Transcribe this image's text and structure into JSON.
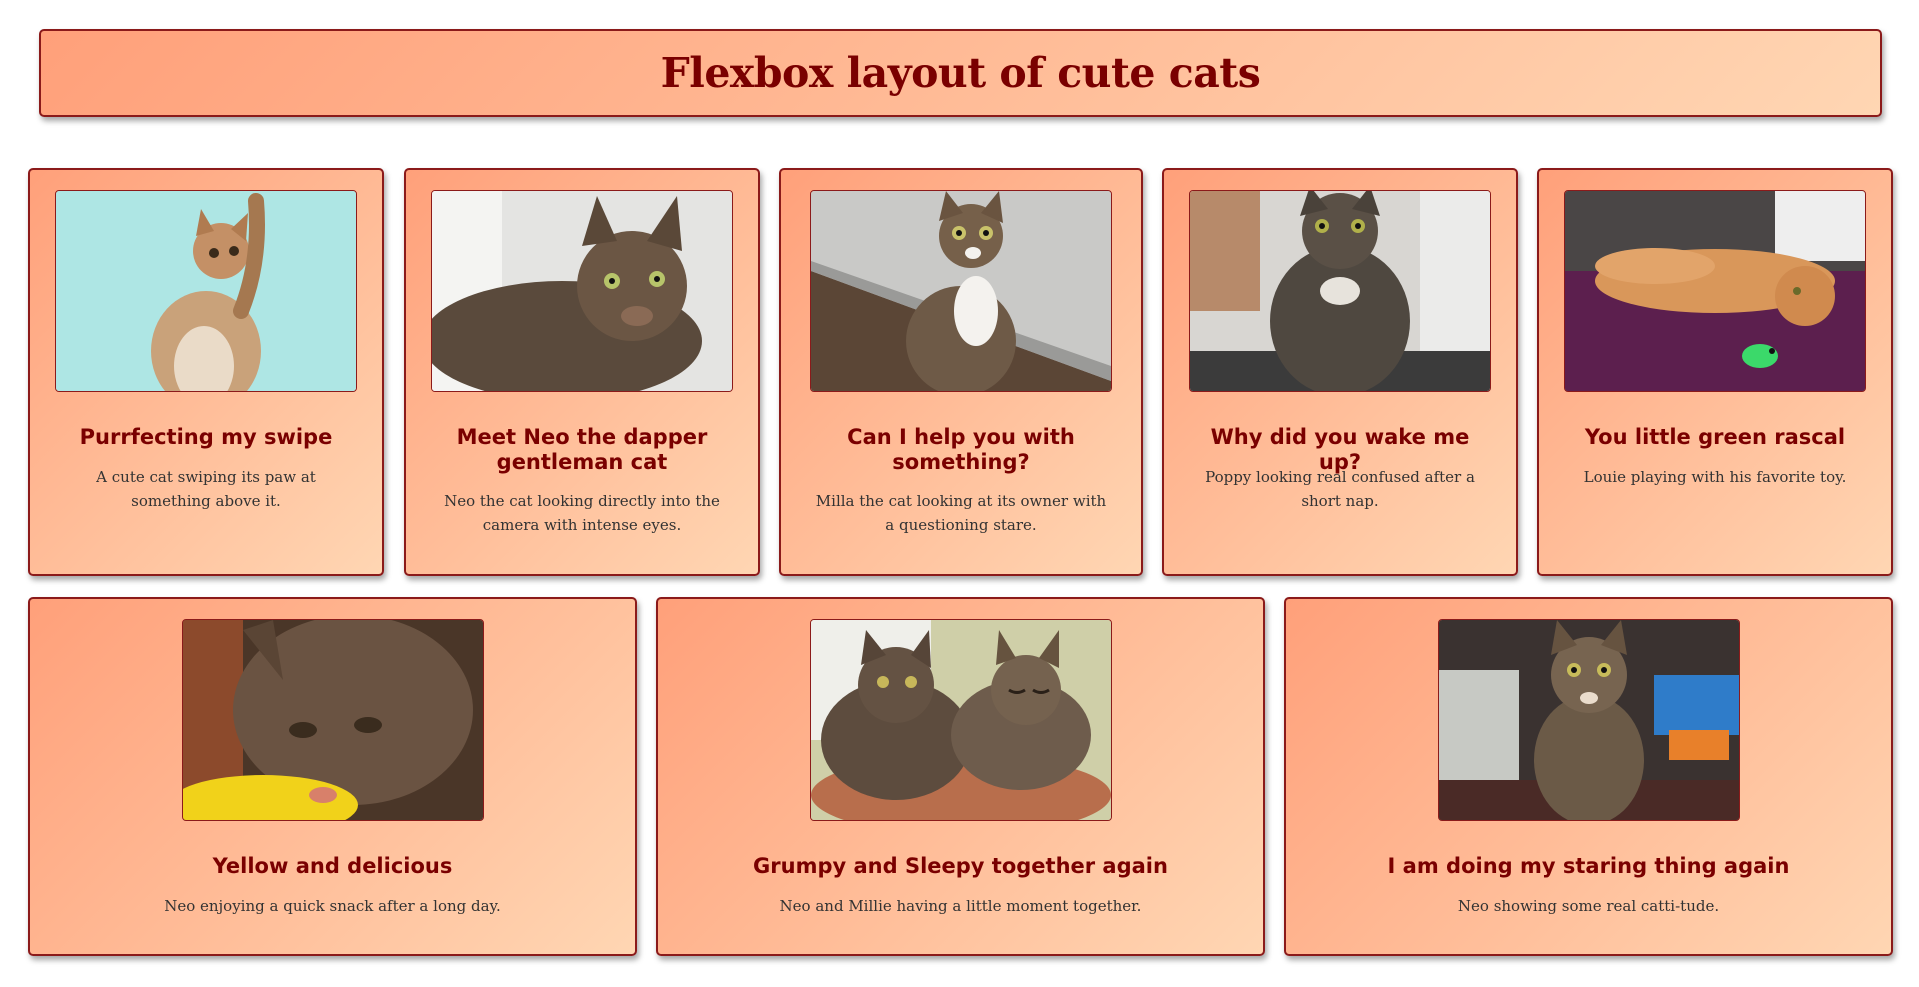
{
  "page": {
    "title": "Flexbox layout of cute cats"
  },
  "colors": {
    "accent": "#7a0000",
    "border": "#8b1a1a",
    "gradient_start": "#ffa07a",
    "gradient_end": "#ffd6b3",
    "text": "#333333"
  },
  "cards": [
    {
      "title": "Purrfecting my swipe",
      "text": "A cute cat swiping its paw at something above it.",
      "image": "kitten-swiping-photo"
    },
    {
      "title": "Meet Neo the dapper gentleman cat",
      "text": "Neo the cat looking directly into the camera with intense eyes.",
      "image": "tabby-lying-photo"
    },
    {
      "title": "Can I help you with something?",
      "text": "Milla the cat looking at its owner with a questioning stare.",
      "image": "tabby-white-sitting-photo"
    },
    {
      "title": "Why did you wake me up?",
      "text": "Poppy looking real confused after a short nap.",
      "image": "fluffy-cat-photo"
    },
    {
      "title": "You little green rascal",
      "text": "Louie playing with his favorite toy.",
      "image": "orange-cat-toy-photo"
    },
    {
      "title": "Yellow and delicious",
      "text": "Neo enjoying a quick snack after a long day.",
      "image": "cat-eating-photo"
    },
    {
      "title": "Grumpy and Sleepy together again",
      "text": "Neo and Millie having a little moment together.",
      "image": "two-cats-photo"
    },
    {
      "title": "I am doing my staring thing again",
      "text": "Neo showing some real catti-tude.",
      "image": "tabby-staring-photo"
    }
  ]
}
